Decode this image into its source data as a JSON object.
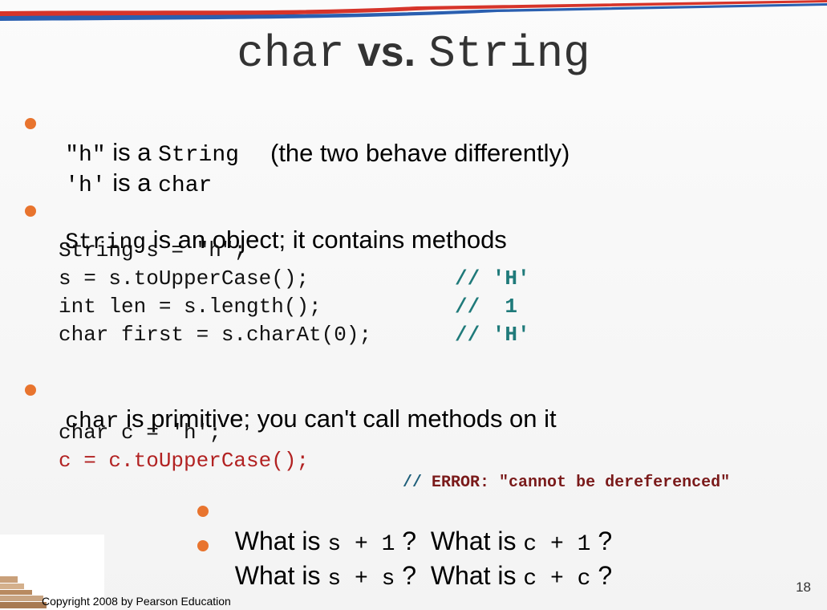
{
  "title": {
    "part1": "char",
    "vs": "vs.",
    "part2": "String"
  },
  "bullets": [
    {
      "lines": [
        {
          "code1": "\"h\"",
          "text1": " is a ",
          "code2": "String"
        },
        {
          "code1": "'h'",
          "text1": " is a ",
          "code2": "char",
          "text2": "(the two behave differently)"
        }
      ]
    },
    {
      "code": "String",
      "text": " is an object; it contains methods"
    },
    {
      "code": "char",
      "text": " is primitive; you can't call methods on it"
    }
  ],
  "code_block_1": [
    {
      "code": "String s = \"h\";",
      "comment": ""
    },
    {
      "code": "s = s.toUpperCase();",
      "comment": "// 'H'"
    },
    {
      "code": "int len = s.length();",
      "comment": "//  1"
    },
    {
      "code": "char first = s.charAt(0);",
      "comment": "// 'H'"
    }
  ],
  "code_block_2": [
    {
      "code": "char c = 'h';"
    },
    {
      "code": "c = c.toUpperCase();",
      "comment_slashes": "//",
      "comment_text": " ERROR: \"cannot be dereferenced\""
    }
  ],
  "questions": [
    {
      "t1": "What is ",
      "c1": "s + 1",
      "t2": " ?  What is ",
      "c2": "c + 1",
      "t3": " ?"
    },
    {
      "t1": "What is ",
      "c1": "s + s",
      "t2": " ?  What is ",
      "c2": "c + c",
      "t3": " ?"
    }
  ],
  "footer": {
    "copyright": "Copyright 2008 by Pearson Education",
    "page_number": "18"
  },
  "colors": {
    "bullet": "#e8742e",
    "comment": "#1f7a7a",
    "error": "#b22222",
    "title": "#333333"
  }
}
